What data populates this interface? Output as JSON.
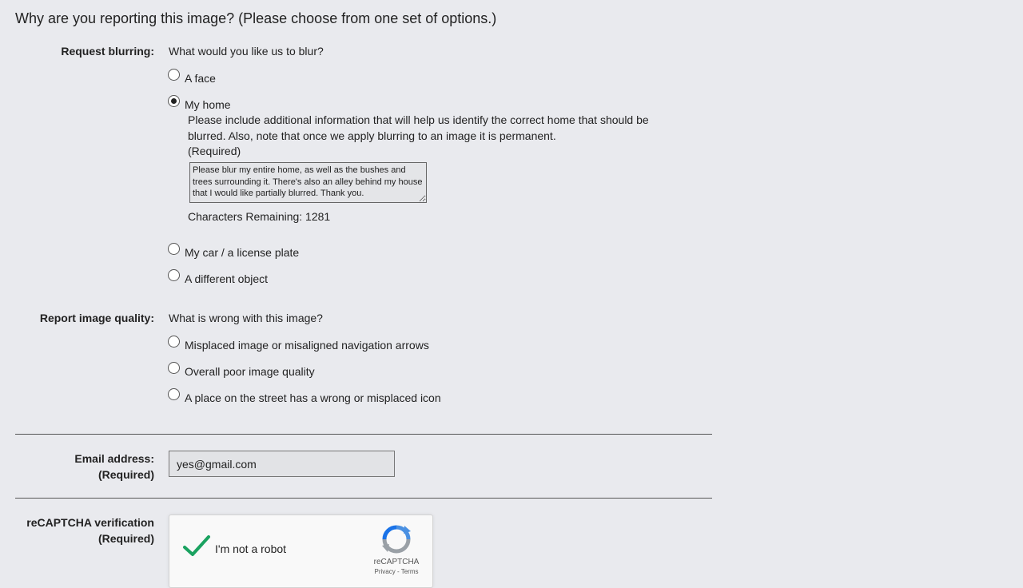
{
  "header": {
    "title": "Why are you reporting this image?  (Please choose from one set of options.)"
  },
  "blurring": {
    "label": "Request blurring:",
    "question": "What would you like us to blur?",
    "options": [
      "A face",
      "My home",
      "My car / a license plate",
      "A different object"
    ],
    "selected": "My home",
    "help_text": "Please include additional information that will help us identify the correct home that should be blurred. Also, note that once we apply blurring to an image it is permanent.",
    "required_note": "(Required)",
    "details_value": "Please blur my entire home, as well as the bushes and trees surrounding it. There's also an alley behind my house that I would like partially blurred. Thank you.",
    "chars_remaining": "Characters Remaining: 1281"
  },
  "quality": {
    "label": "Report image quality:",
    "question": "What is wrong with this image?",
    "options": [
      "Misplaced image or misaligned navigation arrows",
      "Overall poor image quality",
      "A place on the street has a wrong or misplaced icon"
    ]
  },
  "email": {
    "label": "Email address:",
    "required": "(Required)",
    "value": "yes@gmail.com"
  },
  "recaptcha": {
    "label": "reCAPTCHA verification",
    "required": "(Required)",
    "text": "I'm not a robot",
    "brand": "reCAPTCHA",
    "links": "Privacy - Terms",
    "check_color": "#1aa260"
  }
}
